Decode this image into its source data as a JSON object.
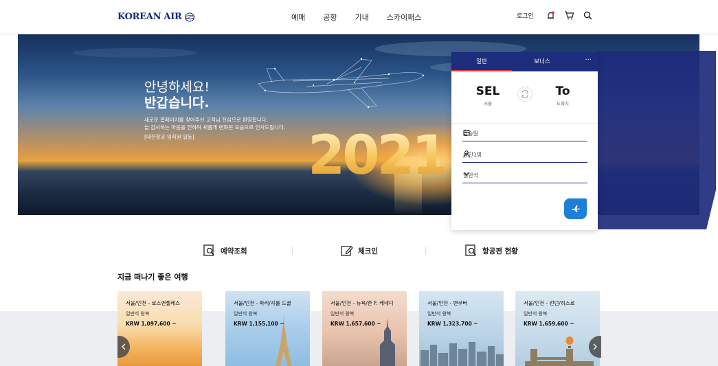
{
  "header": {
    "logo_text": "KOREAN AIR",
    "nav": [
      "예매",
      "공항",
      "기내",
      "스카이패스"
    ],
    "login_label": "로그인"
  },
  "hero": {
    "greeting_line1": "안녕하세요!",
    "greeting_line2": "반갑습니다.",
    "message_line1": "새로운 홈페이지를 찾아주신 고객님 진심으로 환영합니다.",
    "message_line2": "늘 감사하는 마음을 전하며 새롭게 변화된 모습으로 인사드립니다.",
    "signature": "[대한항공 임직원 일동]",
    "year": "2021"
  },
  "booking": {
    "tabs": [
      "일반",
      "보너스"
    ],
    "more_label": "···",
    "origin_code": "SEL",
    "origin_name": "서울",
    "destination_code": "To",
    "destination_name": "도착지",
    "date_placeholder": "탑승일",
    "passengers": "성인1명",
    "cabin_class": "일반석"
  },
  "quick_links": [
    "예약조회",
    "체크인",
    "항공편 현황"
  ],
  "section_title": "지금 떠나기 좋은 여행",
  "destinations": [
    {
      "route": "서울/인천 - 로스앤젤레스",
      "class": "일반석 왕복",
      "price": "KRW 1,097,600 ~"
    },
    {
      "route": "서울/인천 - 파리/샤를 드골",
      "class": "일반석 왕복",
      "price": "KRW 1,155,100 ~"
    },
    {
      "route": "서울/인천 - 뉴욕/존 F. 케네디",
      "class": "일반석 왕복",
      "price": "KRW 1,657,600 ~"
    },
    {
      "route": "서울/인천 - 밴쿠버",
      "class": "일반석 왕복",
      "price": "KRW 1,323,700 ~"
    },
    {
      "route": "서울/인천 - 런던/히스로",
      "class": "일반석 왕복",
      "price": "KRW 1,659,600 ~"
    }
  ],
  "colors": {
    "brand_navy": "#1c2d7e",
    "accent_red": "#e8333c",
    "search_blue": "#1e7fd9"
  }
}
